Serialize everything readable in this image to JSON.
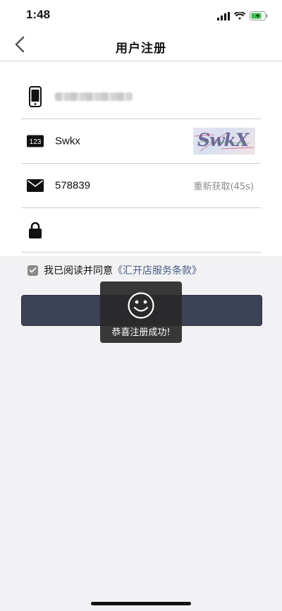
{
  "status_bar": {
    "time": "1:48"
  },
  "nav": {
    "title": "用户注册"
  },
  "form": {
    "phone_value": "",
    "captcha_input": "Swkx",
    "captcha_image_text": "SwkX",
    "sms_code": "578839",
    "resend_label": "重新获取(45s)",
    "password_value": ""
  },
  "agreement": {
    "prefix": "我已阅读并同意",
    "terms_link": "《汇开店服务条款》",
    "checked": true
  },
  "submit": {
    "label": ""
  },
  "toast": {
    "message": "恭喜注册成功!"
  },
  "icons": [
    "back-chevron-icon",
    "phone-icon",
    "captcha-123-icon",
    "mail-icon",
    "lock-icon",
    "check-icon",
    "smiley-icon"
  ]
}
